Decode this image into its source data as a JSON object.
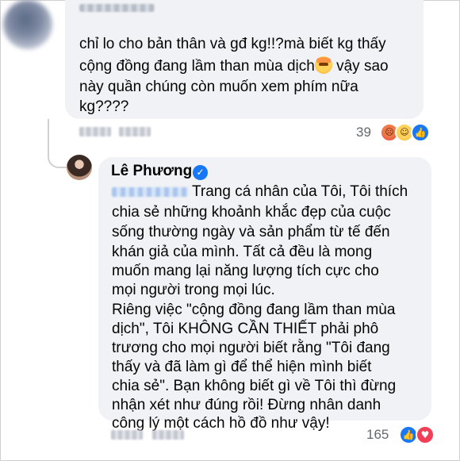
{
  "comment": {
    "lines": [
      "chỉ lo cho bản thân và gđ kg!!?mà biết kg thấy",
      "cộng đồng đang lầm than mùa dịch",
      " vậy sao",
      "này quần chúng còn muốn xem phím nữa",
      "kg????"
    ],
    "emoji": "exploding-head-emoji",
    "reaction_count": "39",
    "reactions": [
      "angry",
      "haha",
      "like"
    ]
  },
  "reply": {
    "author": "Lê Phương",
    "verified_icon": "verified-badge-icon",
    "lines": [
      "Trang cá nhân của Tôi, Tôi thích",
      "chia sẻ những khoảnh khắc đẹp của cuộc",
      "sống thường ngày và sản phẩm từ tế đến",
      "khán giả của mình. Tất cả đều là mong",
      "muốn mang lại năng lượng tích cực cho",
      "mọi người trong mọi lúc.",
      "Riêng việc \"cộng đồng đang lầm than mùa",
      "dịch\", Tôi KHÔNG CẦN THIẾT phải phô",
      "trương cho mọi người biết rằng \"Tôi đang",
      "thấy và đã làm gì để thể hiện mình biết",
      "chia sẻ\". Bạn không biết gì về Tôi thì đừng",
      "nhận xét như đúng rồi! Đừng nhân danh",
      "công lý một cách hồ đồ như vậy!"
    ],
    "reaction_count": "165",
    "reactions": [
      "like",
      "love"
    ]
  }
}
